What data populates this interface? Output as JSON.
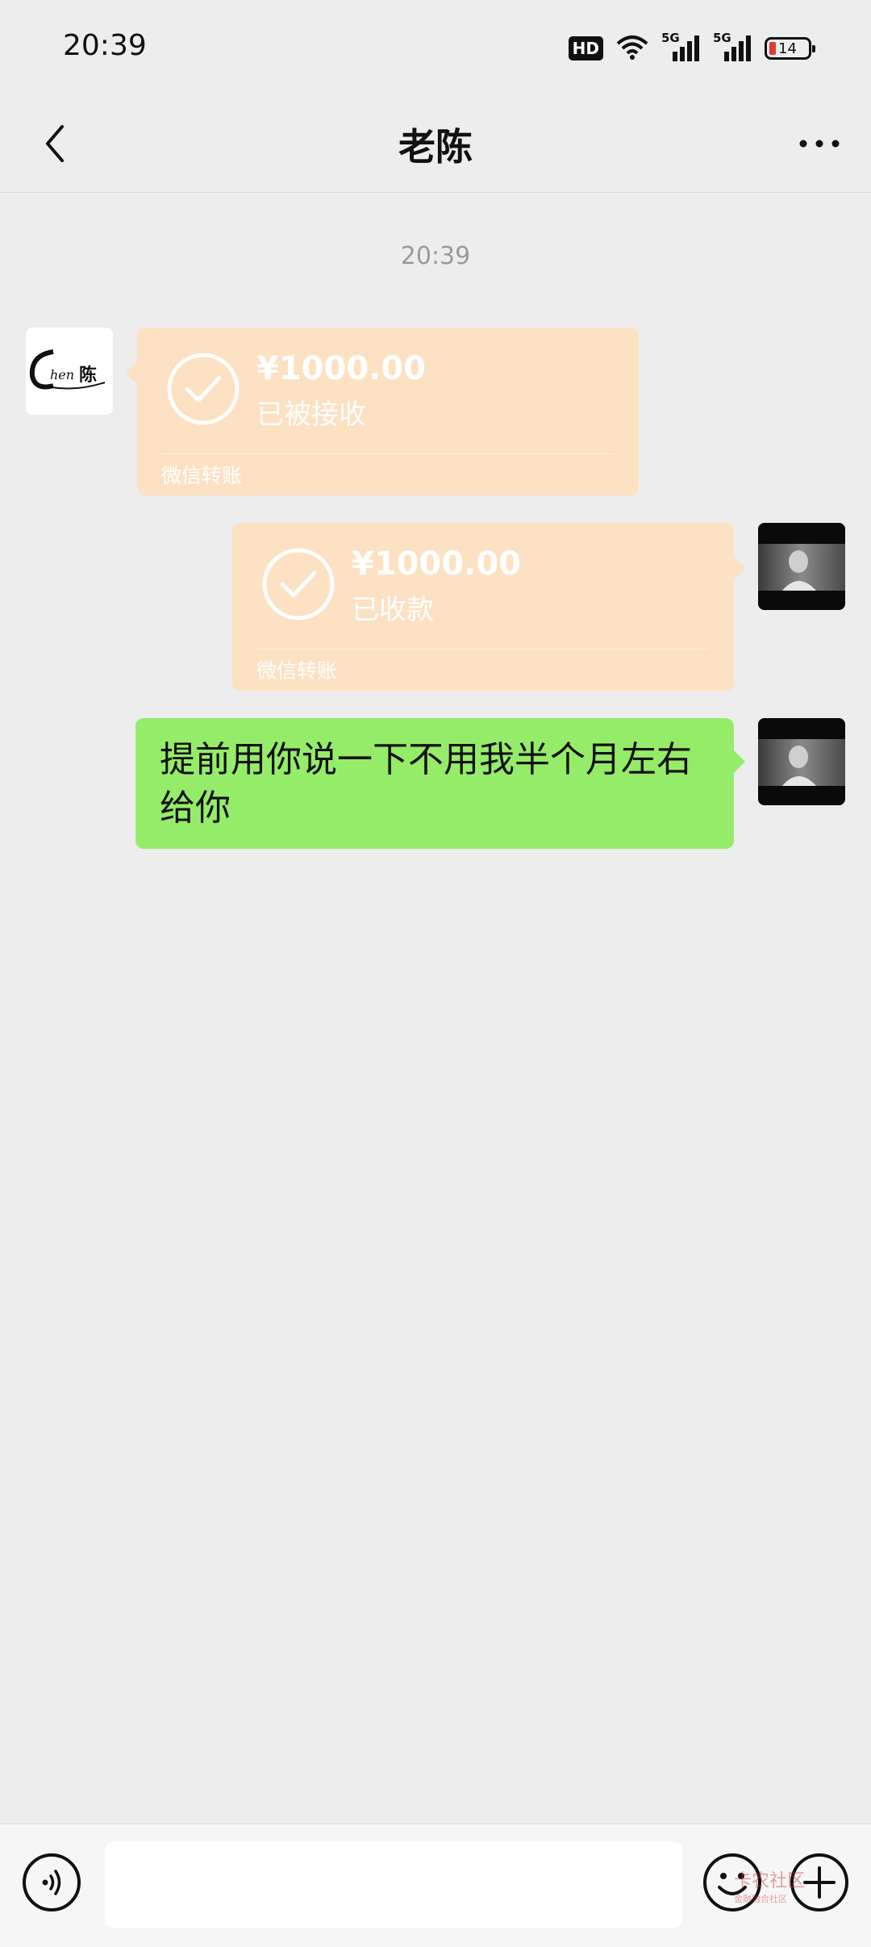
{
  "status_bar": {
    "time": "20:39",
    "hd_label": "HD",
    "signal1_label": "5G",
    "signal2_label": "5G",
    "battery_level": "14"
  },
  "header": {
    "title": "老陈"
  },
  "chat": {
    "timestamp": "20:39",
    "messages": [
      {
        "type": "transfer",
        "sender": "contact",
        "amount": "¥1000.00",
        "status": "已被接收",
        "footer": "微信转账"
      },
      {
        "type": "transfer",
        "sender": "me",
        "amount": "¥1000.00",
        "status": "已收款",
        "footer": "微信转账"
      },
      {
        "type": "text",
        "sender": "me",
        "text": "提前用你说一下不用我半个月左右给你"
      }
    ]
  },
  "contact_avatar": {
    "logo_text": "Chen陈"
  },
  "watermark": {
    "text": "卡农社区",
    "sub": "金融融合社区"
  },
  "colors": {
    "background": "#ededed",
    "transfer_card": "#fde1c3",
    "my_bubble": "#95ec69"
  }
}
